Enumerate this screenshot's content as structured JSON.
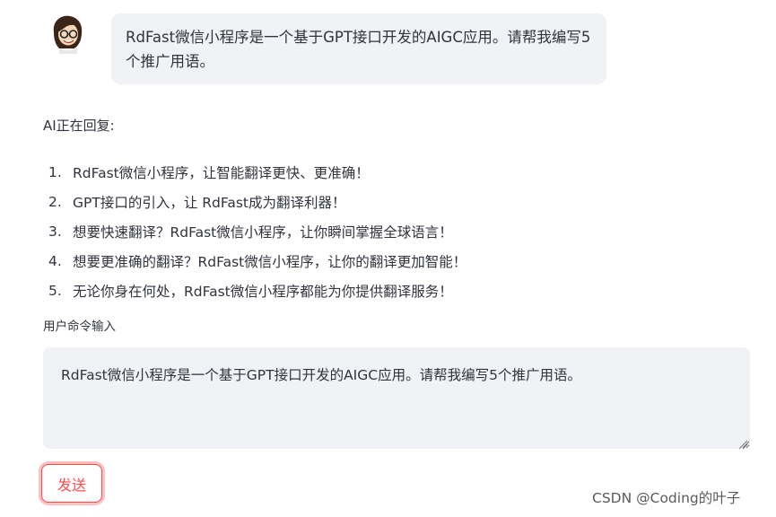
{
  "chat": {
    "user_message": "RdFast微信小程序是一个基于GPT接口开发的AIGC应用。请帮我编写5个推广用语。",
    "avatar_icon": "user-avatar-illustration"
  },
  "reply": {
    "status": "AI正在回复:",
    "items": [
      {
        "num": "1.",
        "text": "RdFast微信小程序，让智能翻译更快、更准确！"
      },
      {
        "num": "2.",
        "text": "GPT接口的引入，让 RdFast成为翻译利器！"
      },
      {
        "num": "3.",
        "text": "想要快速翻译？RdFast微信小程序，让你瞬间掌握全球语言！"
      },
      {
        "num": "4.",
        "text": "想要更准确的翻译？RdFast微信小程序，让你的翻译更加智能！"
      },
      {
        "num": "5.",
        "text": "无论你身在何处，RdFast微信小程序都能为你提供翻译服务！"
      }
    ]
  },
  "input": {
    "label": "用户命令输入",
    "value": "RdFast微信小程序是一个基于GPT接口开发的AIGC应用。请帮我编写5个推广用语。"
  },
  "send_button": {
    "label": "发送"
  },
  "watermark": "CSDN @Coding的叶子",
  "colors": {
    "bubble_bg": "#f0f2f6",
    "text": "#31333f",
    "accent": "#ff4b4b"
  }
}
